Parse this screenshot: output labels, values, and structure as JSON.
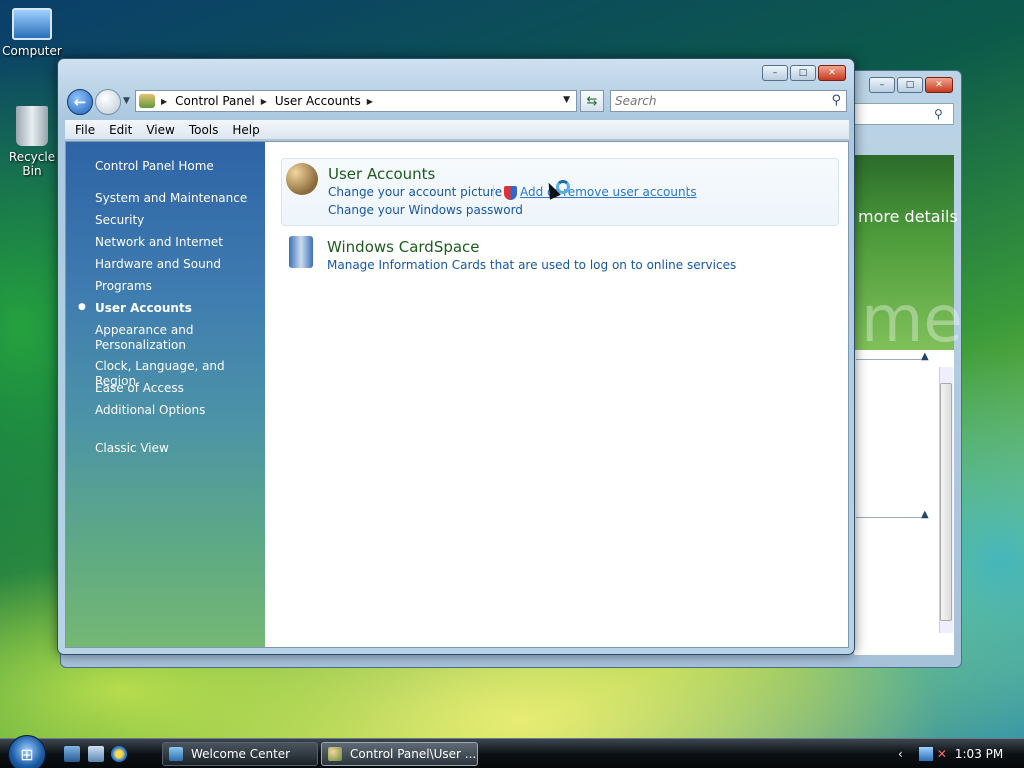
{
  "desktop": {
    "icons": [
      {
        "label": "Computer"
      },
      {
        "label": "Recycle Bin"
      }
    ]
  },
  "background_window": {
    "partial_text": "more details",
    "partial_large_text": "me"
  },
  "window": {
    "controls": {
      "minimize": "–",
      "maximize": "□",
      "close": "✕"
    },
    "breadcrumb": [
      "Control Panel",
      "User Accounts"
    ],
    "search_placeholder": "Search",
    "menu": [
      "File",
      "Edit",
      "View",
      "Tools",
      "Help"
    ],
    "sidebar": {
      "home": "Control Panel Home",
      "items": [
        "System and Maintenance",
        "Security",
        "Network and Internet",
        "Hardware and Sound",
        "Programs",
        "User Accounts",
        "Appearance and Personalization",
        "Clock, Language, and Region",
        "Ease of Access",
        "Additional Options"
      ],
      "current": "User Accounts",
      "classic": "Classic View"
    },
    "categories": [
      {
        "title": "User Accounts",
        "links": [
          "Change your account picture",
          "Add or remove user accounts",
          "Change your Windows password"
        ]
      },
      {
        "title": "Windows CardSpace",
        "links": [
          "Manage Information Cards that are used to log on to online services"
        ]
      }
    ]
  },
  "taskbar": {
    "start_icon": "windows-logo",
    "buttons": [
      {
        "label": "Welcome Center"
      },
      {
        "label": "Control Panel\\User ..."
      }
    ],
    "clock": "1:03 PM"
  },
  "colors": {
    "sidebar_top": "#2e64a6",
    "link": "#1558a6",
    "category_title": "#1d5c1d"
  }
}
